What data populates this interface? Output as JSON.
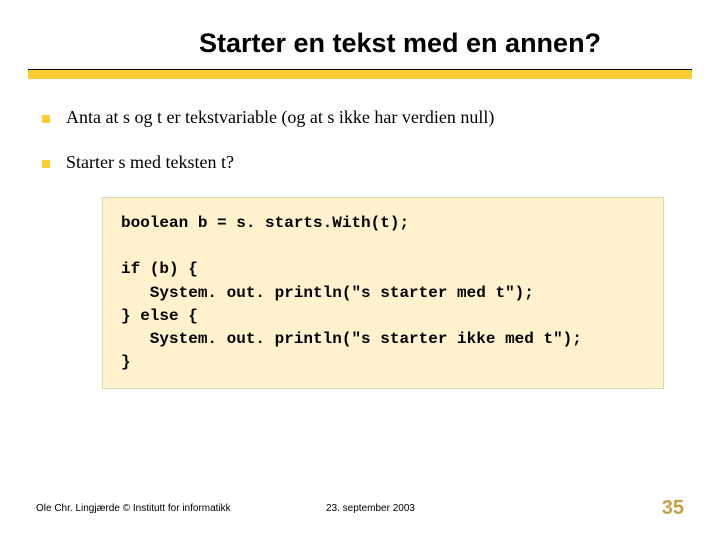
{
  "title": "Starter en tekst med en annen?",
  "bullets": [
    "Anta at s og t er tekstvariable (og at s ikke har verdien null)",
    "Starter s med teksten t?"
  ],
  "code": "boolean b = s. starts.With(t);\n\nif (b) {\n   System. out. println(\"s starter med t\");\n} else {\n   System. out. println(\"s starter ikke med t\");\n}",
  "footer": {
    "author": "Ole Chr. Lingjærde © Institutt for informatikk",
    "date": "23. september 2003",
    "page": "35"
  }
}
